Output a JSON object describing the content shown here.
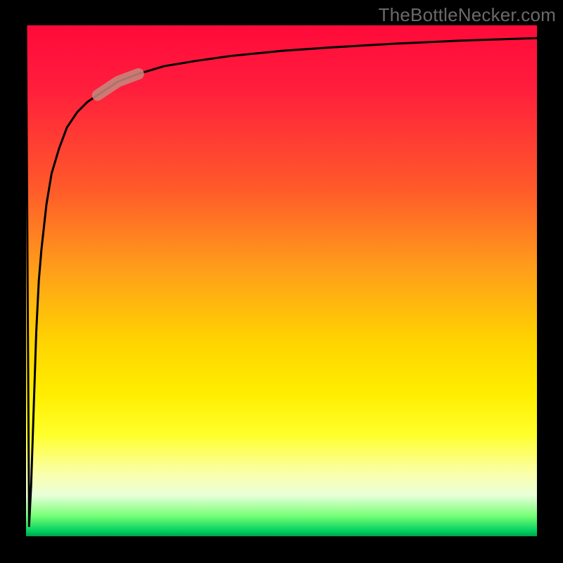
{
  "watermark": "TheBottleNecker.com",
  "colors": {
    "frame": "#000000",
    "curve": "#000000",
    "highlight": "#c58a7e"
  },
  "chart_data": {
    "type": "line",
    "title": "",
    "xlabel": "",
    "ylabel": "",
    "xlim": [
      0,
      100
    ],
    "ylim": [
      0,
      100
    ],
    "grid": false,
    "legend": false,
    "annotations": [
      {
        "kind": "highlight-segment",
        "x_range": [
          14,
          22
        ],
        "note": "thick rounded marker on curve"
      }
    ],
    "series": [
      {
        "name": "curve",
        "x": [
          0,
          0.6,
          1.0,
          1.5,
          2.0,
          2.5,
          3.0,
          4.0,
          5.0,
          6.5,
          8.0,
          10.0,
          12.0,
          15.0,
          18.0,
          22.0,
          27.0,
          33.0,
          40.0,
          50.0,
          60.0,
          72.0,
          85.0,
          100.0
        ],
        "y": [
          100,
          2,
          10,
          25,
          40,
          50,
          56,
          65,
          71,
          76,
          80,
          83,
          85,
          87,
          89,
          90.5,
          92,
          93,
          94,
          95,
          95.7,
          96.4,
          97,
          97.5
        ]
      }
    ]
  }
}
